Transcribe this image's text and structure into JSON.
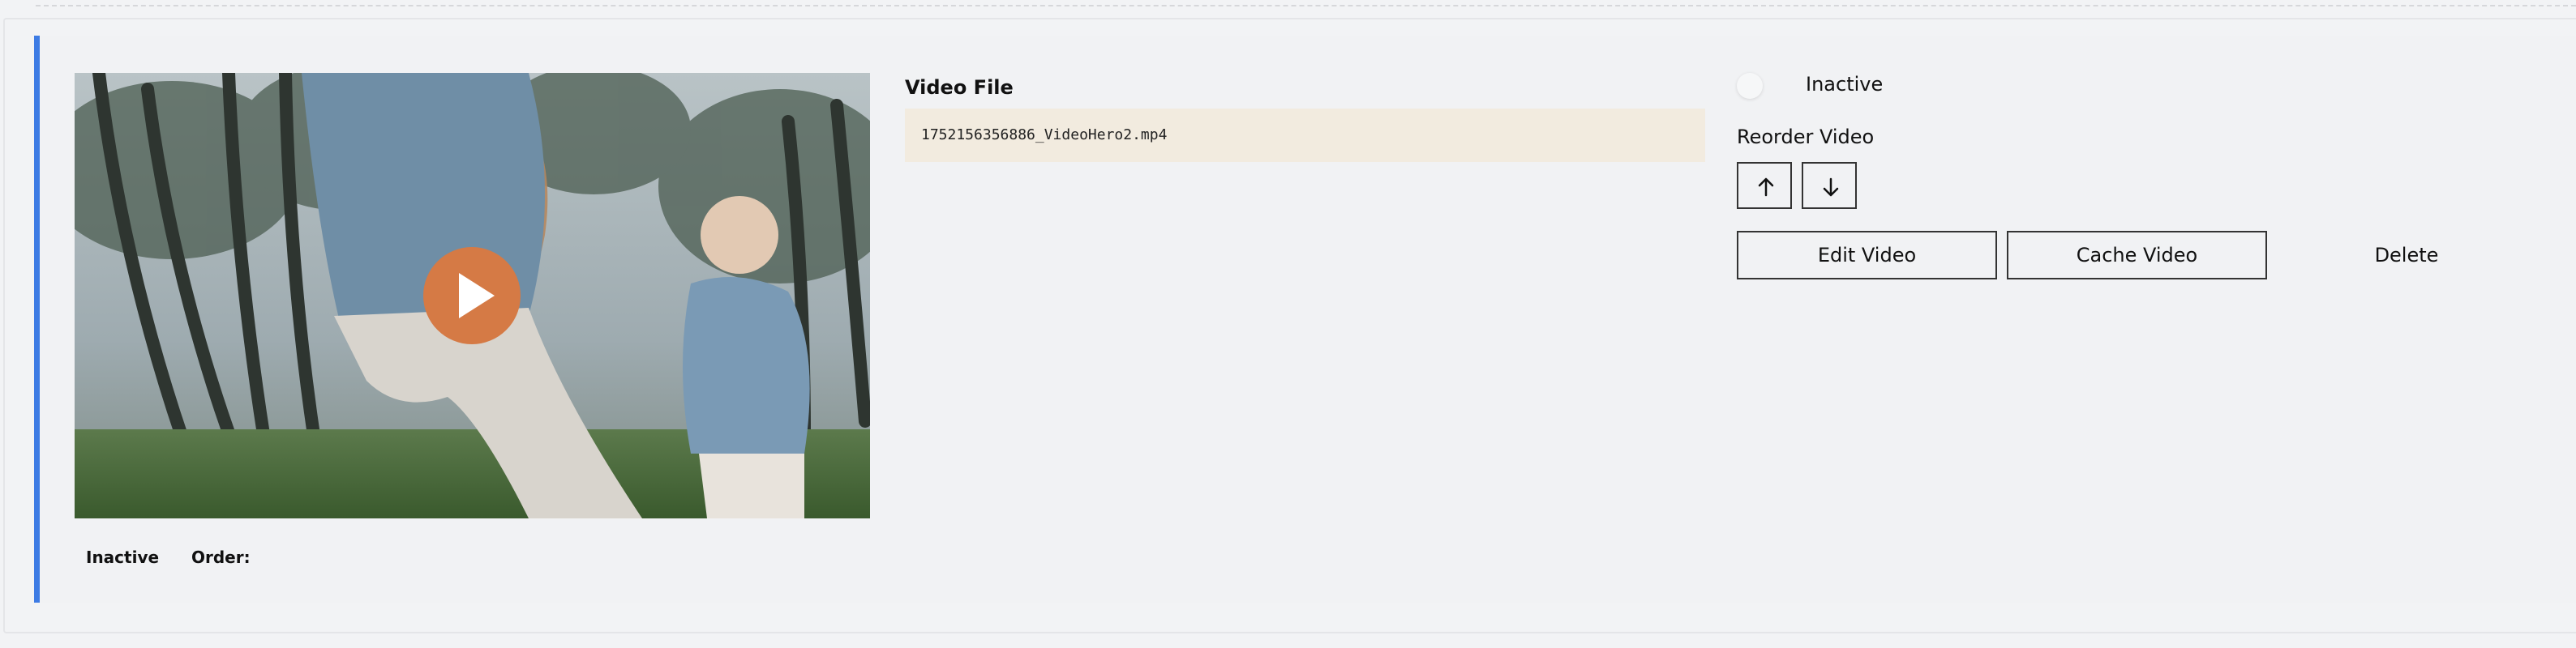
{
  "video_card": {
    "thumbnail_alt": "Video thumbnail",
    "file_label": "Video File",
    "file_name": "1752156356886_VideoHero2.mp4",
    "status_toggle_label": "Inactive",
    "reorder_label": "Reorder Video",
    "move_up_icon": "arrow-up-icon",
    "move_down_icon": "arrow-down-icon",
    "edit_label": "Edit Video",
    "cache_label": "Cache Video",
    "delete_label": "Delete",
    "status_chip": "Inactive",
    "order_chip": "Order:"
  },
  "colors": {
    "accent_border": "#3d7be4",
    "play_button": "#d57a45",
    "file_box_bg": "#f2ebdf"
  }
}
